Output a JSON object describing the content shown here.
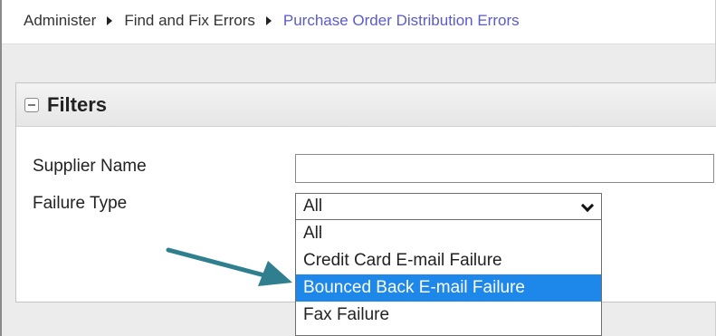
{
  "breadcrumb": {
    "items": [
      "Administer",
      "Find and Fix Errors"
    ],
    "current": "Purchase Order Distribution Errors"
  },
  "filters": {
    "title": "Filters",
    "supplier_name_label": "Supplier Name",
    "supplier_name_value": "",
    "failure_type_label": "Failure Type",
    "failure_type_selected": "All",
    "failure_type_options": [
      "All",
      "Credit Card E-mail Failure",
      "Bounced Back E-mail Failure",
      "Fax Failure"
    ],
    "highlighted_option": "Bounced Back E-mail Failure"
  },
  "colors": {
    "breadcrumb_current": "#5b5bc9",
    "option_highlight": "#1e88ea",
    "annotation_arrow": "#2f7f8f"
  },
  "icons": {
    "collapse": "minus-square-icon",
    "breadcrumb_separator": "caret-right-icon",
    "select_chevron": "chevron-down-icon",
    "annotation": "arrow-right-icon"
  }
}
